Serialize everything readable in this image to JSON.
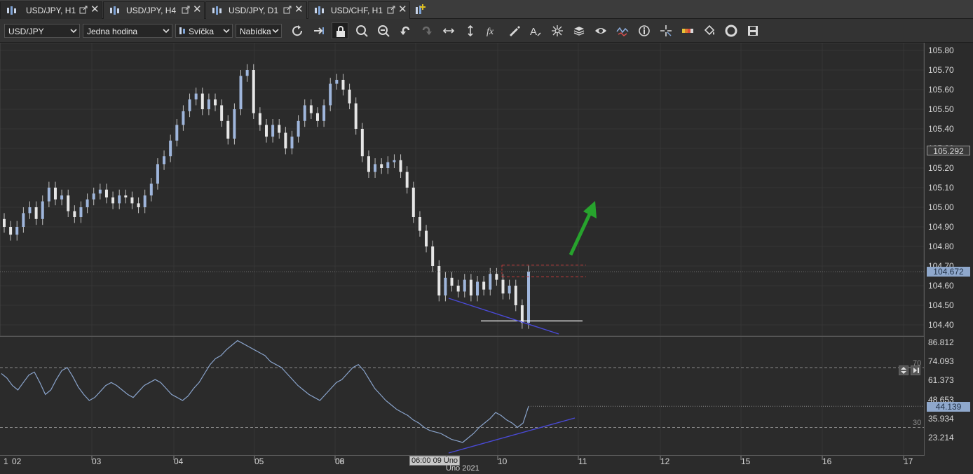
{
  "tabs": [
    {
      "label": "USD/JPY, H1",
      "active": true
    },
    {
      "label": "USD/JPY, H4",
      "active": false
    },
    {
      "label": "USD/JPY, D1",
      "active": false
    },
    {
      "label": "USD/CHF, H1",
      "active": false
    }
  ],
  "toolbar": {
    "instrument": "USD/JPY",
    "period": "Jedna hodina",
    "chart_type": "Svíčka",
    "offer_side": "Nabídka",
    "icons": [
      "refresh-icon",
      "shift-chart-icon",
      "lock-icon",
      "zoom-in-icon",
      "zoom-out-icon",
      "undo-icon",
      "redo-icon",
      "horizontal-resize-icon",
      "vertical-resize-icon",
      "indicators-fx-icon",
      "pen-draw-icon",
      "text-tool-icon",
      "cursor-crosshair-icon",
      "layers-icon",
      "eye-icon",
      "signals-icon",
      "info-icon",
      "crosshair-icon",
      "color-bar-icon",
      "paint-bucket-icon",
      "lifebuoy-icon",
      "save-icon"
    ]
  },
  "price_axis": {
    "labels": [
      "105.80",
      "105.70",
      "105.60",
      "105.50",
      "105.40",
      "105.30",
      "105.20",
      "105.10",
      "105.00",
      "104.90",
      "104.80",
      "104.70",
      "104.60",
      "104.50",
      "104.40"
    ],
    "current_high_tag": "105.292",
    "current_price_tag": "104.672"
  },
  "oscillator_axis": {
    "labels": [
      "86.812",
      "74.093",
      "61.373",
      "48.653",
      "35.934",
      "23.214"
    ],
    "current_value_tag": "44.139",
    "level_high": "70",
    "level_low": "30"
  },
  "time_axis": {
    "labels": [
      "1",
      "02",
      "03",
      "04",
      "05",
      "06",
      "08",
      "09",
      "10",
      "11",
      "12",
      "15",
      "16",
      "17"
    ],
    "crosshair_label": "06:00 09 Úno",
    "month_label": "Úno 2021"
  },
  "chart_data": [
    {
      "type": "candlestick",
      "instrument": "USD/JPY",
      "period": "H1",
      "ylim": [
        104.35,
        105.83
      ],
      "candles": [
        {
          "o": 104.94,
          "c": 104.9
        },
        {
          "o": 104.9,
          "c": 104.86
        },
        {
          "o": 104.86,
          "c": 104.9
        },
        {
          "o": 104.9,
          "c": 104.97
        },
        {
          "o": 104.97,
          "c": 105.0
        },
        {
          "o": 105.0,
          "c": 104.94
        },
        {
          "o": 104.94,
          "c": 105.03
        },
        {
          "o": 105.03,
          "c": 105.1
        },
        {
          "o": 105.1,
          "c": 105.04
        },
        {
          "o": 105.04,
          "c": 105.06
        },
        {
          "o": 105.06,
          "c": 104.98
        },
        {
          "o": 104.98,
          "c": 104.95
        },
        {
          "o": 104.95,
          "c": 105.0
        },
        {
          "o": 105.0,
          "c": 105.04
        },
        {
          "o": 105.04,
          "c": 105.07
        },
        {
          "o": 105.07,
          "c": 105.09
        },
        {
          "o": 105.09,
          "c": 105.05
        },
        {
          "o": 105.05,
          "c": 105.02
        },
        {
          "o": 105.02,
          "c": 105.06
        },
        {
          "o": 105.06,
          "c": 105.05
        },
        {
          "o": 105.05,
          "c": 105.02
        },
        {
          "o": 105.02,
          "c": 105.0
        },
        {
          "o": 105.0,
          "c": 105.06
        },
        {
          "o": 105.06,
          "c": 105.12
        },
        {
          "o": 105.12,
          "c": 105.22
        },
        {
          "o": 105.22,
          "c": 105.26
        },
        {
          "o": 105.26,
          "c": 105.34
        },
        {
          "o": 105.34,
          "c": 105.42
        },
        {
          "o": 105.42,
          "c": 105.49
        },
        {
          "o": 105.49,
          "c": 105.55
        },
        {
          "o": 105.55,
          "c": 105.58
        },
        {
          "o": 105.58,
          "c": 105.5
        },
        {
          "o": 105.5,
          "c": 105.55
        },
        {
          "o": 105.55,
          "c": 105.52
        },
        {
          "o": 105.52,
          "c": 105.44
        },
        {
          "o": 105.44,
          "c": 105.35
        },
        {
          "o": 105.35,
          "c": 105.5
        },
        {
          "o": 105.5,
          "c": 105.67
        },
        {
          "o": 105.67,
          "c": 105.7
        },
        {
          "o": 105.7,
          "c": 105.48
        },
        {
          "o": 105.48,
          "c": 105.42
        },
        {
          "o": 105.42,
          "c": 105.36
        },
        {
          "o": 105.36,
          "c": 105.42
        },
        {
          "o": 105.42,
          "c": 105.38
        },
        {
          "o": 105.38,
          "c": 105.3
        },
        {
          "o": 105.3,
          "c": 105.36
        },
        {
          "o": 105.36,
          "c": 105.44
        },
        {
          "o": 105.44,
          "c": 105.52
        },
        {
          "o": 105.52,
          "c": 105.48
        },
        {
          "o": 105.48,
          "c": 105.44
        },
        {
          "o": 105.44,
          "c": 105.52
        },
        {
          "o": 105.52,
          "c": 105.63
        },
        {
          "o": 105.63,
          "c": 105.65
        },
        {
          "o": 105.65,
          "c": 105.6
        },
        {
          "o": 105.6,
          "c": 105.53
        },
        {
          "o": 105.53,
          "c": 105.4
        },
        {
          "o": 105.4,
          "c": 105.26
        },
        {
          "o": 105.26,
          "c": 105.18
        },
        {
          "o": 105.18,
          "c": 105.22
        },
        {
          "o": 105.22,
          "c": 105.2
        },
        {
          "o": 105.2,
          "c": 105.23
        },
        {
          "o": 105.23,
          "c": 105.24
        },
        {
          "o": 105.24,
          "c": 105.18
        },
        {
          "o": 105.18,
          "c": 105.1
        },
        {
          "o": 105.1,
          "c": 104.95
        },
        {
          "o": 104.95,
          "c": 104.88
        },
        {
          "o": 104.88,
          "c": 104.8
        },
        {
          "o": 104.8,
          "c": 104.7
        },
        {
          "o": 104.7,
          "c": 104.55
        },
        {
          "o": 104.55,
          "c": 104.64
        },
        {
          "o": 104.64,
          "c": 104.6
        },
        {
          "o": 104.6,
          "c": 104.57
        },
        {
          "o": 104.57,
          "c": 104.63
        },
        {
          "o": 104.63,
          "c": 104.55
        },
        {
          "o": 104.55,
          "c": 104.62
        },
        {
          "o": 104.62,
          "c": 104.58
        },
        {
          "o": 104.58,
          "c": 104.66
        },
        {
          "o": 104.66,
          "c": 104.63
        },
        {
          "o": 104.63,
          "c": 104.56
        },
        {
          "o": 104.56,
          "c": 104.6
        },
        {
          "o": 104.6,
          "c": 104.5
        },
        {
          "o": 104.5,
          "c": 104.41
        },
        {
          "o": 104.41,
          "c": 104.672
        }
      ],
      "resistance_zone": [
        104.645,
        104.705
      ],
      "support_level": 104.42,
      "trendline": [
        {
          "x": 0.67,
          "y": 104.53
        },
        {
          "x": 0.83,
          "y": 104.36
        }
      ],
      "arrow_direction": "up"
    },
    {
      "type": "line",
      "name": "RSI",
      "ylim": [
        15,
        90
      ],
      "levels": [
        70,
        30
      ],
      "values": [
        66,
        63,
        58,
        55,
        60,
        65,
        67,
        60,
        52,
        55,
        62,
        68,
        70,
        64,
        57,
        52,
        48,
        50,
        54,
        58,
        60,
        58,
        55,
        52,
        50,
        54,
        58,
        60,
        62,
        60,
        56,
        52,
        50,
        48,
        51,
        56,
        60,
        66,
        72,
        76,
        78,
        82,
        85,
        88,
        86,
        84,
        82,
        80,
        78,
        74,
        72,
        70,
        66,
        62,
        58,
        55,
        52,
        50,
        48,
        52,
        56,
        60,
        62,
        66,
        70,
        72,
        68,
        62,
        56,
        52,
        48,
        45,
        42,
        40,
        38,
        35,
        33,
        30,
        28,
        27,
        26,
        24,
        22,
        21,
        20,
        23,
        26,
        30,
        33,
        36,
        40,
        38,
        35,
        33,
        30,
        33,
        44.139
      ]
    }
  ]
}
